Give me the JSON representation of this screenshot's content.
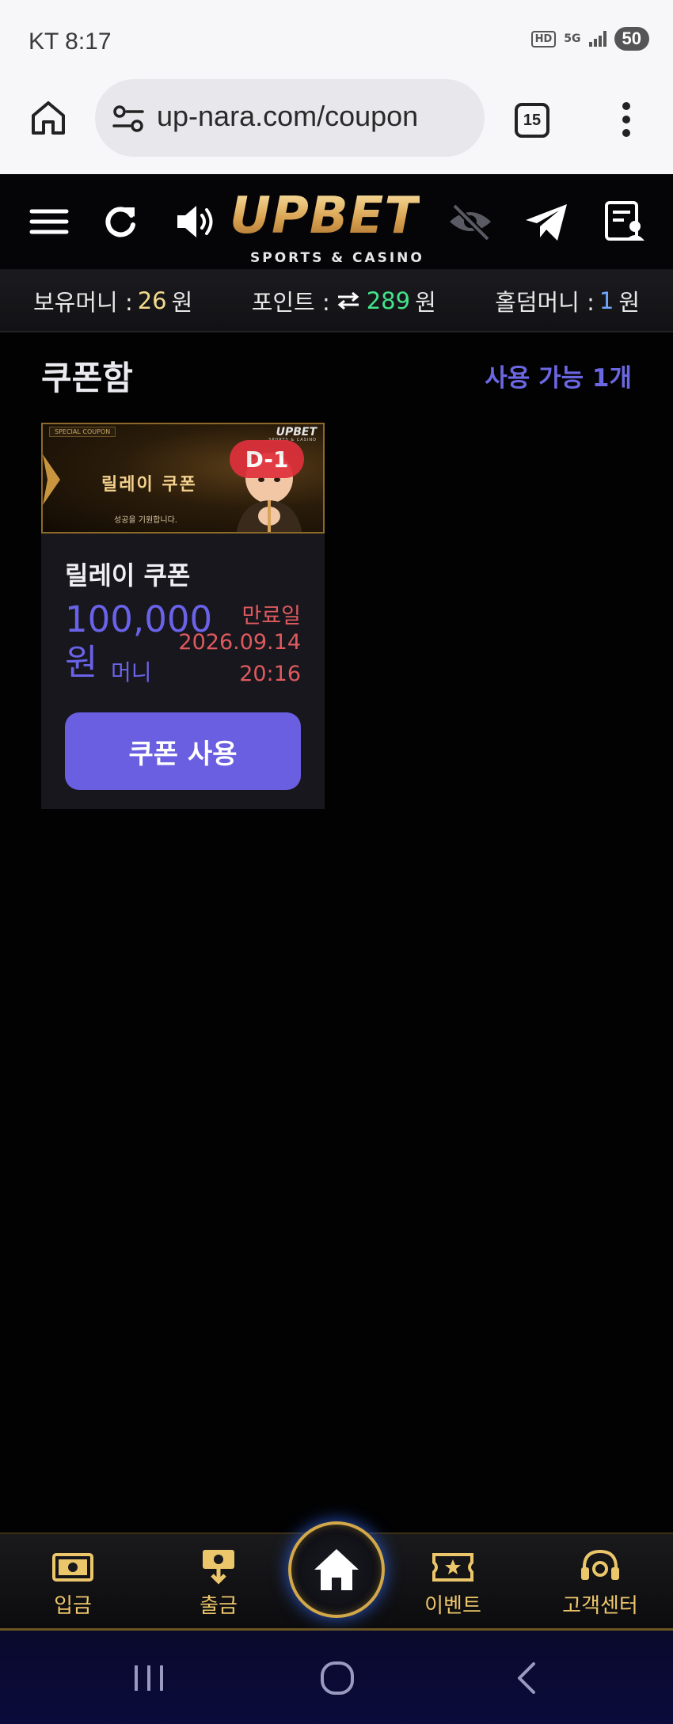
{
  "status_bar": {
    "carrier_time": "KT 8:17",
    "hd": "HD",
    "network": "5G",
    "battery": "50"
  },
  "browser": {
    "url": "up-nara.com/coupon",
    "tab_count": "15"
  },
  "site": {
    "logo_main": "UPBET",
    "logo_sub": "SPORTS & CASINO"
  },
  "balance": {
    "money_label": "보유머니 :",
    "money_value": "26",
    "money_unit": "원",
    "point_label": "포인트 :",
    "point_value": "289",
    "point_unit": "원",
    "holdem_label": "홀덤머니 :",
    "holdem_value": "1",
    "holdem_unit": "원"
  },
  "coupon_box": {
    "title": "쿠폰함",
    "available": "사용 가능 1개"
  },
  "coupon": {
    "banner_tag": "SPECIAL COUPON",
    "banner_title": "릴레이 쿠폰",
    "banner_sub": "성공을 기원합니다.",
    "banner_logo": "UPBET",
    "banner_logo_sub": "SPORTS & CASINO",
    "d_day": "D-1",
    "name": "릴레이 쿠폰",
    "amount": "100,000",
    "amount_unit": "원",
    "amount_type": "머니",
    "expiry_label": "만료일",
    "expiry_date": "2026.09.14",
    "expiry_time": "20:16",
    "use_button": "쿠폰 사용"
  },
  "bottom_nav": {
    "deposit": "입금",
    "withdraw": "출금",
    "event": "이벤트",
    "support": "고객센터"
  },
  "colors": {
    "accent_purple": "#6a5fe0",
    "gold": "#ecc66a",
    "expiry_red": "#df5a5f",
    "point_green": "#45e38a"
  }
}
